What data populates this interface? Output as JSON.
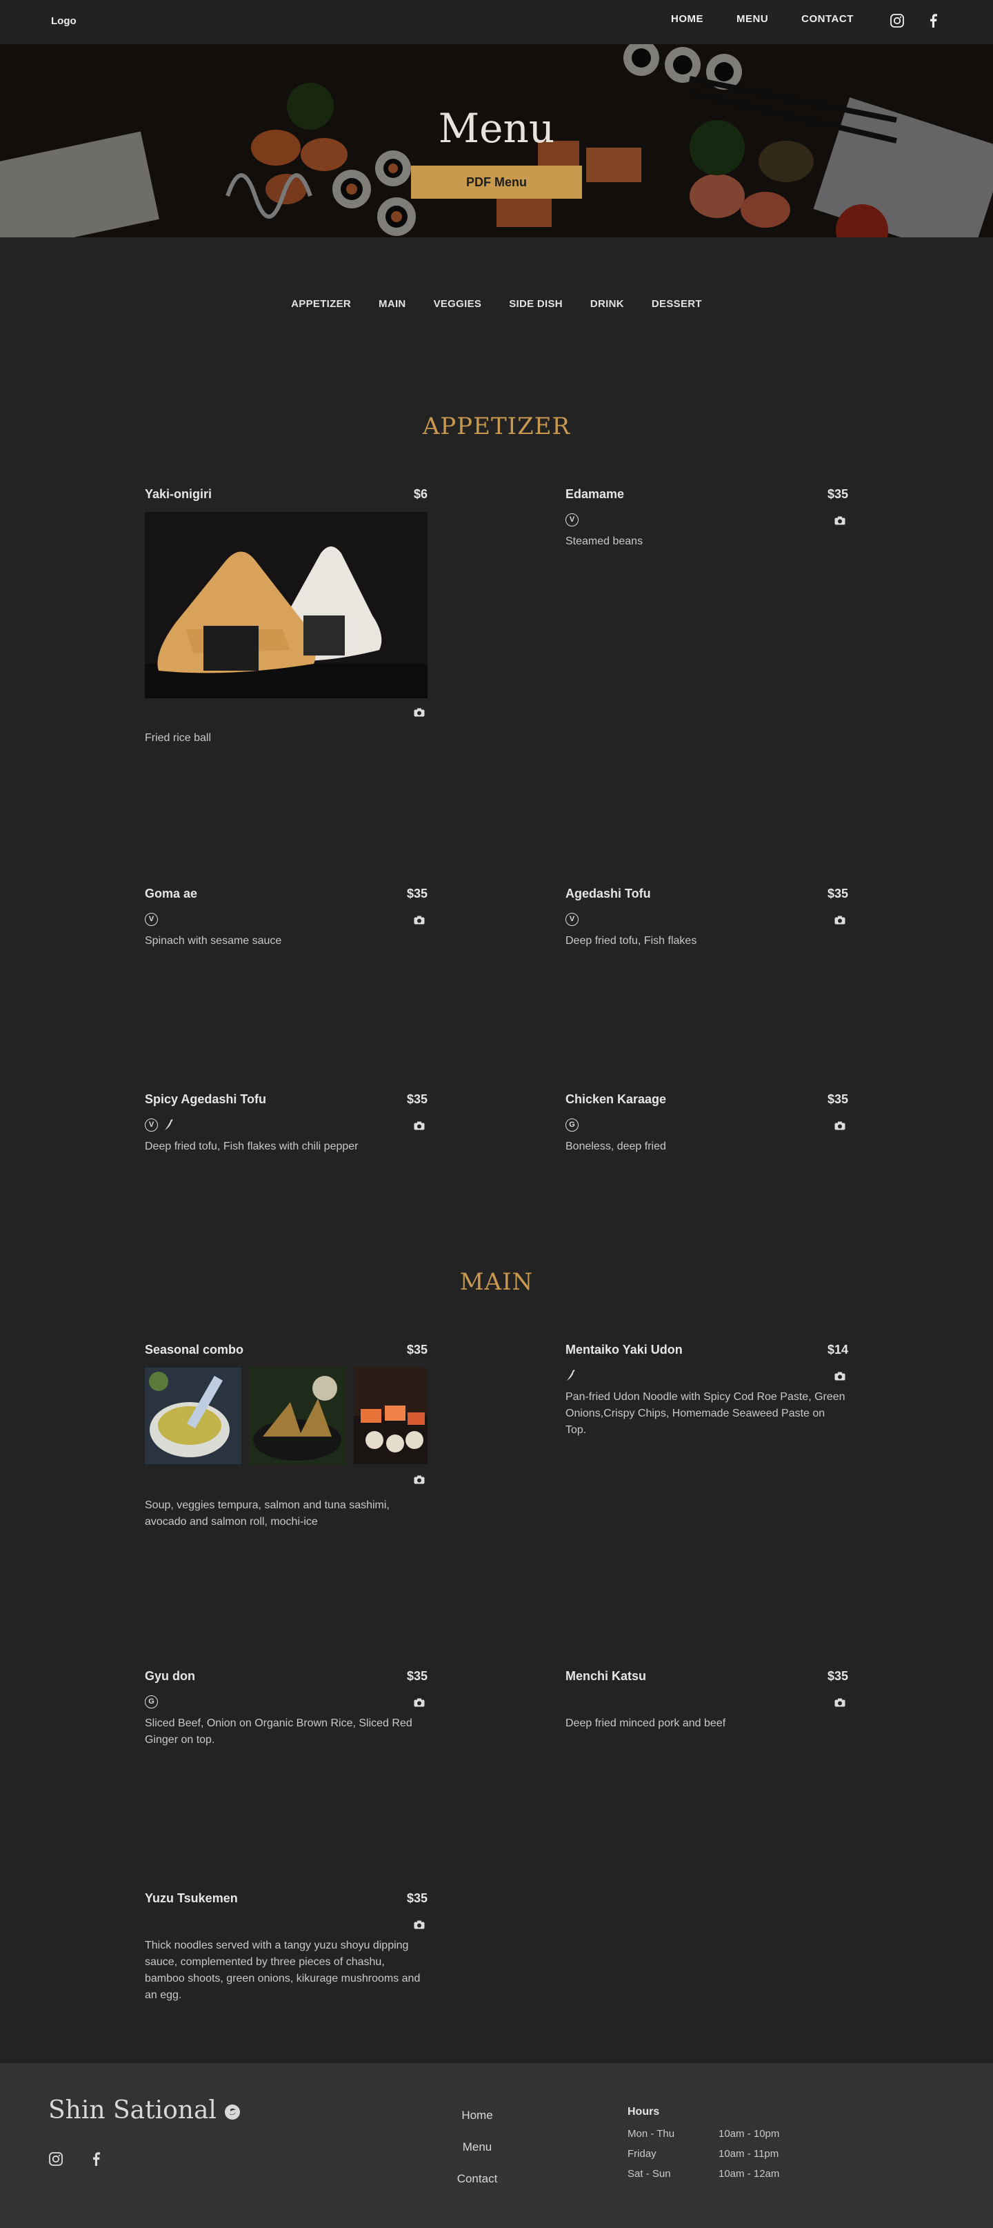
{
  "nav": {
    "logo": "Logo",
    "links": [
      "HOME",
      "MENU",
      "CONTACT"
    ]
  },
  "hero": {
    "title": "Menu",
    "pdf_button": "PDF Menu"
  },
  "categories": [
    "APPETIZER",
    "MAIN",
    "VEGGIES",
    "SIDE DISH",
    "DRINK",
    "DESSERT"
  ],
  "sections": {
    "appetizer": {
      "title": "APPETIZER",
      "items": [
        {
          "name": "Yaki-onigiri",
          "price": "$6",
          "desc": "Fried rice ball"
        },
        {
          "name": "Edamame",
          "price": "$35",
          "badge": "V",
          "desc": "Steamed beans"
        },
        {
          "name": "Goma ae",
          "price": "$35",
          "badge": "V",
          "desc": "Spinach with sesame sauce"
        },
        {
          "name": "Agedashi Tofu",
          "price": "$35",
          "badge": "V",
          "desc": "Deep fried tofu, Fish flakes"
        },
        {
          "name": "Spicy Agedashi Tofu",
          "price": "$35",
          "badge": "V",
          "desc": "Deep fried tofu, Fish flakes with chili pepper"
        },
        {
          "name": "Chicken Karaage",
          "price": "$35",
          "badge": "G",
          "desc": "Boneless, deep fried"
        }
      ]
    },
    "main": {
      "title": "MAIN",
      "items": [
        {
          "name": "Seasonal combo",
          "price": "$35",
          "desc": "Soup, veggies tempura, salmon and tuna sashimi, avocado and salmon roll, mochi-ice"
        },
        {
          "name": "Mentaiko Yaki Udon",
          "price": "$14",
          "desc": "Pan-fried Udon Noodle with Spicy Cod Roe Paste, Green Onions,Crispy Chips, Homemade Seaweed Paste on Top."
        },
        {
          "name": "Gyu don",
          "price": "$35",
          "badge": "G",
          "desc": "Sliced Beef, Onion on Organic Brown Rice, Sliced Red Ginger on top."
        },
        {
          "name": "Menchi Katsu",
          "price": "$35",
          "desc": "Deep fried minced pork and beef"
        },
        {
          "name": "Yuzu Tsukemen",
          "price": "$35",
          "desc": "Thick noodles served with a tangy yuzu shoyu dipping sauce, complemented by three pieces of chashu, bamboo shoots, green onions, kikurage mushrooms and an egg."
        }
      ]
    }
  },
  "footer": {
    "brand": "Shin Sational",
    "links": [
      "Home",
      "Menu",
      "Contact"
    ],
    "hours_title": "Hours",
    "hours": [
      {
        "day": "Mon - Thu",
        "time": "10am - 10pm"
      },
      {
        "day": "Friday",
        "time": "10am - 11pm"
      },
      {
        "day": "Sat - Sun",
        "time": "10am - 12am"
      }
    ]
  },
  "colors": {
    "accent": "#c89a4e",
    "background": "#232323",
    "footer": "#333333"
  },
  "icons": [
    "instagram-icon",
    "facebook-icon",
    "camera-icon",
    "vegetarian-icon",
    "gluten-free-icon",
    "spicy-icon"
  ]
}
